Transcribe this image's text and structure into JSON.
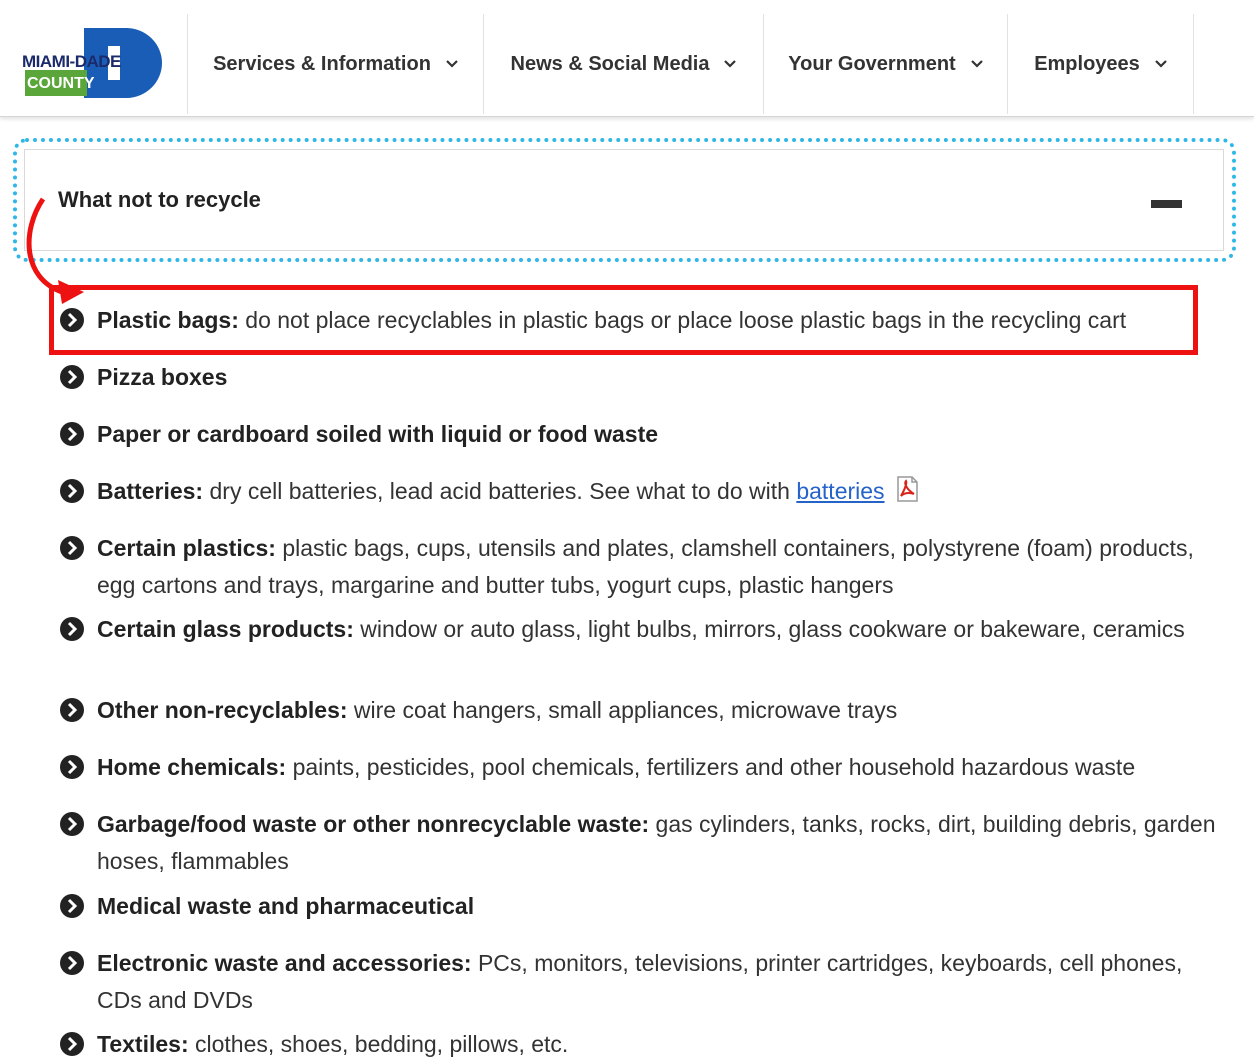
{
  "header": {
    "logo": {
      "line1": "MIAMI-DADE",
      "line2": "COUNTY",
      "colors": {
        "blue": "#1a5db7",
        "green": "#5aa63a"
      }
    },
    "nav": [
      {
        "label": "Services & Information"
      },
      {
        "label": "News & Social Media"
      },
      {
        "label": "Your Government"
      },
      {
        "label": "Employees"
      }
    ]
  },
  "accordion": {
    "title": "What not to recycle",
    "state_icon": "minus-icon"
  },
  "annotation": {
    "highlight_color": "#ee1111",
    "focus_color": "#2fb7e8"
  },
  "items": [
    {
      "label": "Plastic bags:",
      "text": " do not place recyclables in plastic bags or place loose plastic bags in the recycling cart"
    },
    {
      "label": "Pizza boxes",
      "text": ""
    },
    {
      "label": "Paper or cardboard soiled with liquid or food waste",
      "text": ""
    },
    {
      "label": "Batteries:",
      "text": " dry cell batteries, lead acid batteries. See what to do with ",
      "link": "batteries"
    },
    {
      "label": "Certain plastics:",
      "text": " plastic bags, cups, utensils and plates, clamshell containers, polystyrene (foam) products, egg cartons and trays, margarine and butter tubs, yogurt cups, plastic hangers"
    },
    {
      "label": "Certain glass products:",
      "text": " window or auto glass, light bulbs, mirrors, glass cookware or bakeware, ceramics"
    },
    {
      "label": "Other non-recyclables:",
      "text": " wire coat hangers, small appliances, microwave trays"
    },
    {
      "label": "Home chemicals:",
      "text": " paints, pesticides, pool chemicals, fertilizers and other household hazardous waste"
    },
    {
      "label": "Garbage/food waste or other nonrecyclable waste:",
      "text": " gas cylinders, tanks, rocks, dirt, building debris, garden hoses, flammables"
    },
    {
      "label": "Medical waste and pharmaceutical",
      "text": ""
    },
    {
      "label": "Electronic waste and accessories:",
      "text": " PCs, monitors, televisions, printer cartridges, keyboards, cell phones, CDs and DVDs"
    },
    {
      "label": "Textiles:",
      "text": " clothes, shoes, bedding, pillows, etc."
    }
  ]
}
